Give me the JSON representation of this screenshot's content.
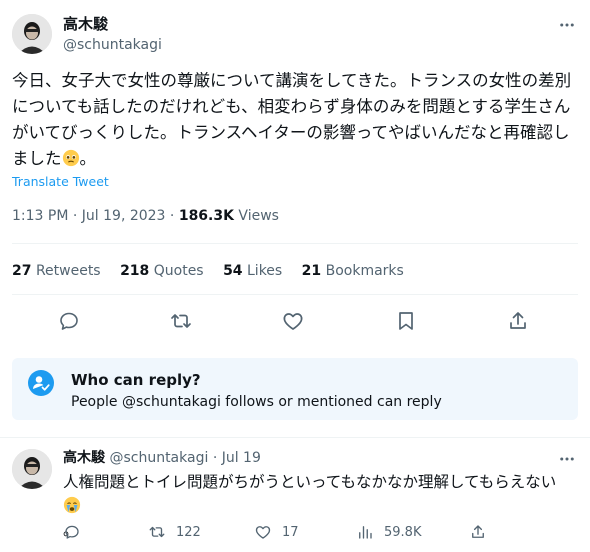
{
  "colors": {
    "accent": "#1d9bf0",
    "text": "#0f1419",
    "muted": "#536471",
    "reply_card_bg": "#f0f7fd"
  },
  "tweet": {
    "author_name": "高木駿",
    "author_handle": "@schuntakagi",
    "text": "今日、女子大で女性の尊厳について講演をしてきた。トランスの女性の差別についても話したのだけれども、相変わらず身体のみを問題とする学生さんがいてびっくりした。トランスヘイターの影響ってやばいんだなと再確認しました",
    "text_end": "。",
    "translate_label": "Translate Tweet",
    "time": "1:13 PM",
    "date": "Jul 19, 2023",
    "views_count": "186.3K",
    "views_label": "Views",
    "stats": {
      "retweets_count": "27",
      "retweets_label": "Retweets",
      "quotes_count": "218",
      "quotes_label": "Quotes",
      "likes_count": "54",
      "likes_label": "Likes",
      "bookmarks_count": "21",
      "bookmarks_label": "Bookmarks"
    },
    "actions": [
      "reply-icon",
      "retweet-icon",
      "like-icon",
      "bookmark-icon",
      "share-icon"
    ]
  },
  "reply_restriction": {
    "title": "Who can reply?",
    "description": "People @schuntakagi follows or mentioned can reply",
    "icon": "person-check-icon"
  },
  "reply": {
    "author_name": "高木駿",
    "author_handle": "@schuntakagi",
    "separator": "·",
    "date": "Jul 19",
    "text": "人権問題とトイレ問題がちがうといってもなかなか理解してもらえない",
    "text_end": "。",
    "retweet_count": "122",
    "like_count": "17",
    "views_count": "59.8K"
  }
}
